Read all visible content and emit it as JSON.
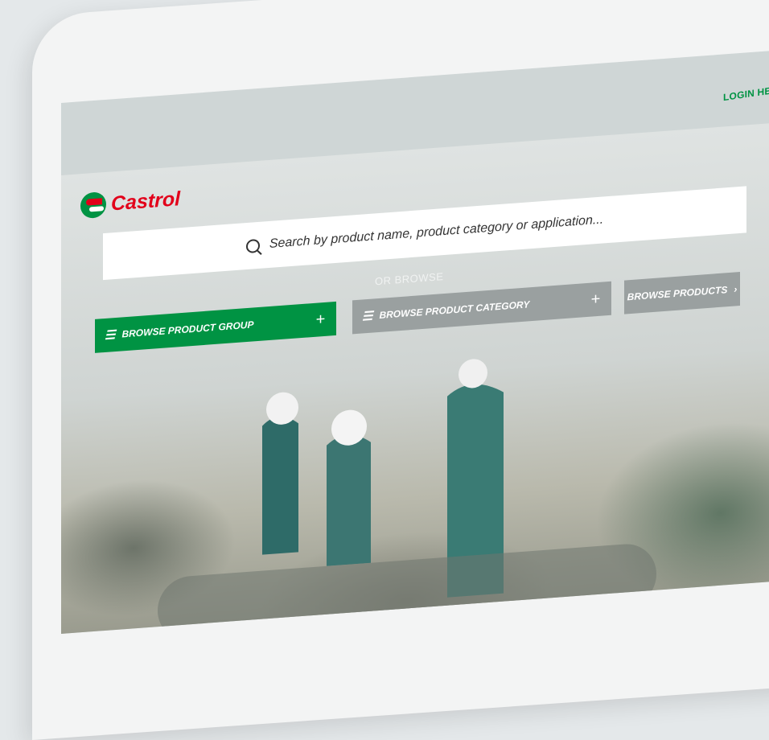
{
  "header": {
    "login_label": "LOGIN HERE"
  },
  "brand": {
    "name": "Castrol",
    "primary": "#009343",
    "accent": "#e2001a"
  },
  "search": {
    "placeholder": "Search by product name, product category or application..."
  },
  "browse": {
    "divider_label": "OR BROWSE",
    "tabs": [
      {
        "label": "BROWSE PRODUCT GROUP",
        "active": true,
        "icon": "list-icon",
        "action_icon": "plus-icon"
      },
      {
        "label": "BROWSE PRODUCT CATEGORY",
        "active": false,
        "icon": "list-icon",
        "action_icon": "plus-icon"
      }
    ],
    "products_button": {
      "label": "BROWSE PRODUCTS",
      "icon": "chevron-right-icon"
    }
  }
}
